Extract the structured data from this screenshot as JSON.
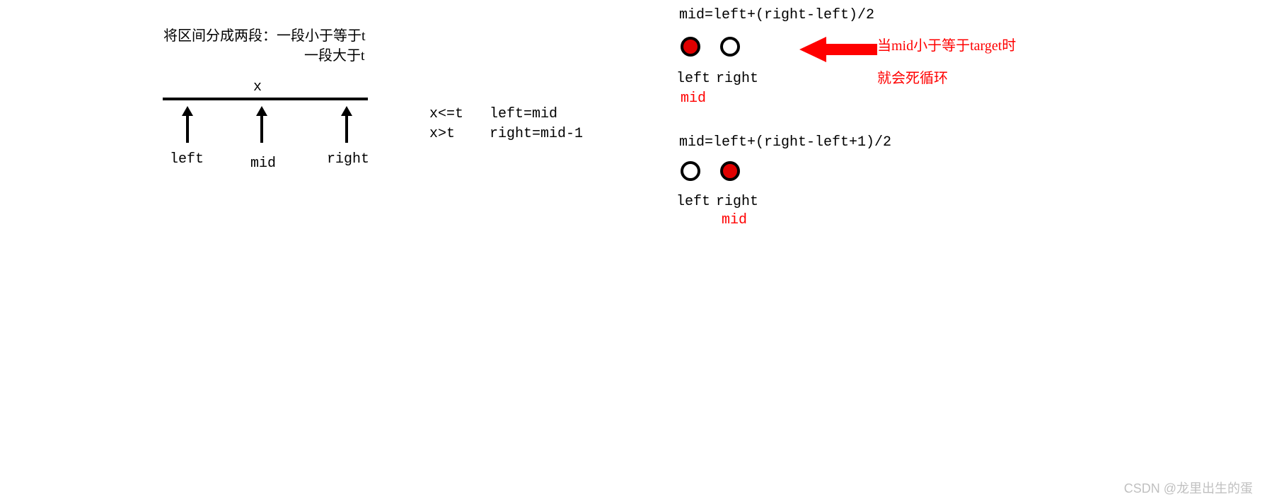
{
  "left_diagram": {
    "title_line1": "将区间分成两段：一段小于等于t",
    "title_line2": "一段大于t",
    "x_label": "x",
    "ptr_left": "left",
    "ptr_mid": "mid",
    "ptr_right": "right",
    "cond1_a": "x<=t",
    "cond1_b": "left=mid",
    "cond2_a": "x>t",
    "cond2_b": "right=mid-1"
  },
  "right_diagram": {
    "formula1": "mid=left+(right-left)/2",
    "case1_left": "left",
    "case1_right": "right",
    "case1_mid": "mid",
    "note_line1": "当mid小于等于target时",
    "note_line2": "就会死循环",
    "formula2": "mid=left+(right-left+1)/2",
    "case2_left": "left",
    "case2_right": "right",
    "case2_mid": "mid"
  },
  "watermark": "CSDN @龙里出生的蛋"
}
